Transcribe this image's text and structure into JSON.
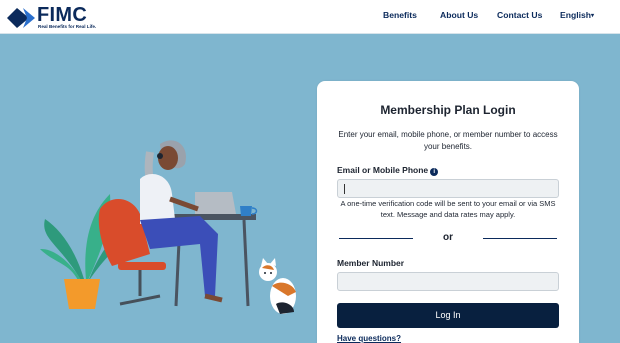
{
  "brand": {
    "name": "FIMC",
    "tagline": "Real Benefits for Real Life.",
    "colors": {
      "navy": "#0b2a5b",
      "button": "#08203f",
      "background": "#7fb6cf"
    }
  },
  "nav": {
    "benefits": "Benefits",
    "about": "About Us",
    "contact": "Contact Us",
    "language": "English"
  },
  "login": {
    "title": "Membership Plan Login",
    "subtitle": "Enter your email, mobile phone, or member number to access your benefits.",
    "email_label": "Email or Mobile Phone",
    "email_value": "",
    "info_icon": "info-icon",
    "hint": "A one-time verification code will be sent to your email or via SMS text. Message and data rates may apply.",
    "or": "or",
    "member_label": "Member Number",
    "member_value": "",
    "button": "Log In",
    "help": "Have questions?"
  }
}
